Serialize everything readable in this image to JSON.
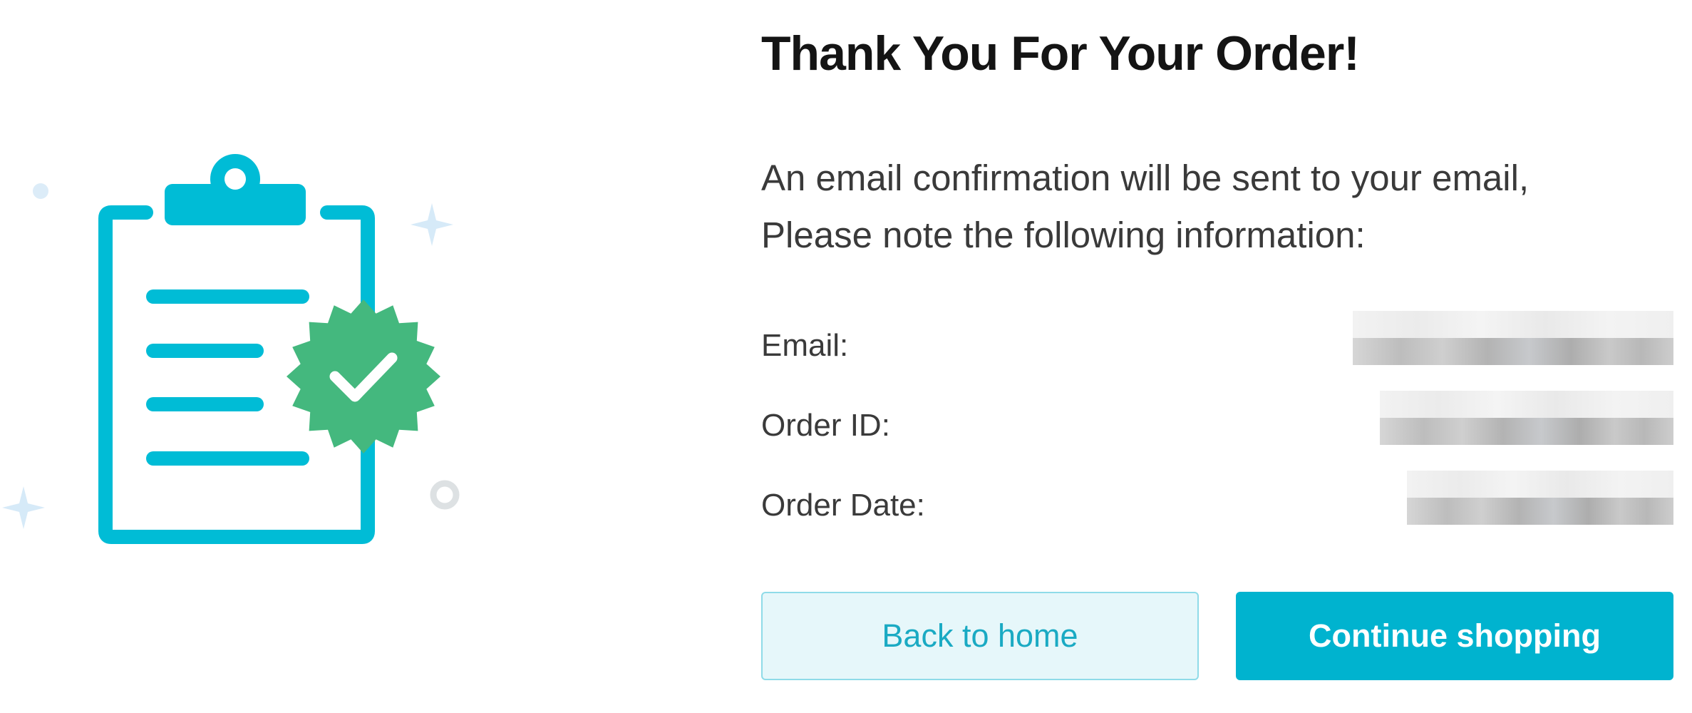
{
  "confirmation": {
    "title": "Thank You For Your Order!",
    "intro_line1": "An email confirmation will be sent to your email,",
    "intro_line2": "Please note the following information:"
  },
  "info": [
    {
      "label": "Email:",
      "value_redacted": true
    },
    {
      "label": "Order ID:",
      "value_redacted": true
    },
    {
      "label": "Order Date:",
      "value_redacted": true
    }
  ],
  "actions": {
    "back_label": "Back to home",
    "continue_label": "Continue shopping"
  },
  "icons": {
    "illustration": "clipboard-check-icon",
    "badge": "verified-badge-icon"
  },
  "colors": {
    "accent": "#00b3cf",
    "badge": "#44b87e",
    "title": "#141414",
    "secondary_bg": "#e6f7fa"
  }
}
